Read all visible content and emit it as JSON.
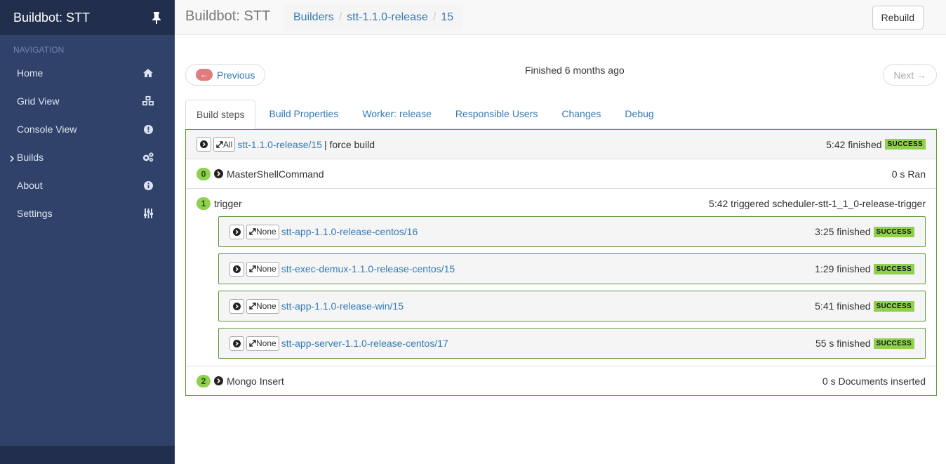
{
  "sidebar": {
    "brand": "Buildbot: STT",
    "nav_header": "NAVIGATION",
    "items": [
      {
        "label": "Home",
        "icon": "home-icon"
      },
      {
        "label": "Grid View",
        "icon": "cubes-icon"
      },
      {
        "label": "Console View",
        "icon": "exclamation-circle-icon"
      },
      {
        "label": "Builds",
        "icon": "cogs-icon"
      },
      {
        "label": "About",
        "icon": "info-circle-icon"
      },
      {
        "label": "Settings",
        "icon": "sliders-icon"
      }
    ]
  },
  "topbar": {
    "title": "Buildbot: STT",
    "breadcrumb": [
      "Builders",
      "stt-1.1.0-release",
      "15"
    ],
    "rebuild_label": "Rebuild"
  },
  "pager": {
    "prev_arrow": "←",
    "prev_label": "Previous",
    "status": "Finished 6 months ago",
    "next_label": "Next →"
  },
  "tabs": [
    "Build steps",
    "Build Properties",
    "Worker: release",
    "Responsible Users",
    "Changes",
    "Debug"
  ],
  "build": {
    "expand_all": "All",
    "link": "stt-1.1.0-release/15",
    "reason": " | force build",
    "summary": "5:42 finished",
    "result": "SUCCESS"
  },
  "steps": [
    {
      "num": "0",
      "name": "MasterShellCommand",
      "summary": "0 s Ran"
    },
    {
      "num": "1",
      "name": "trigger",
      "summary": "5:42 triggered scheduler-stt-1_1_0-release-trigger"
    },
    {
      "num": "2",
      "name": "Mongo Insert",
      "summary": "0 s Documents inserted"
    }
  ],
  "triggered": [
    {
      "expand": "None",
      "link": "stt-app-1.1.0-release-centos/16",
      "summary": "3:25 finished",
      "result": "SUCCESS"
    },
    {
      "expand": "None",
      "link": "stt-exec-demux-1.1.0-release-centos/15",
      "summary": "1:29 finished",
      "result": "SUCCESS"
    },
    {
      "expand": "None",
      "link": "stt-app-1.1.0-release-win/15",
      "summary": "5:41 finished",
      "result": "SUCCESS"
    },
    {
      "expand": "None",
      "link": "stt-app-server-1.1.0-release-centos/17",
      "summary": "55 s finished",
      "result": "SUCCESS"
    }
  ],
  "colors": {
    "sidebar_bg": "#30426a",
    "sidebar_dark": "#212f4c",
    "success": "#8fd14f",
    "link": "#337ab7",
    "panel_border": "#5f9b3a",
    "prev_arrow_bg": "#e07c7c"
  }
}
